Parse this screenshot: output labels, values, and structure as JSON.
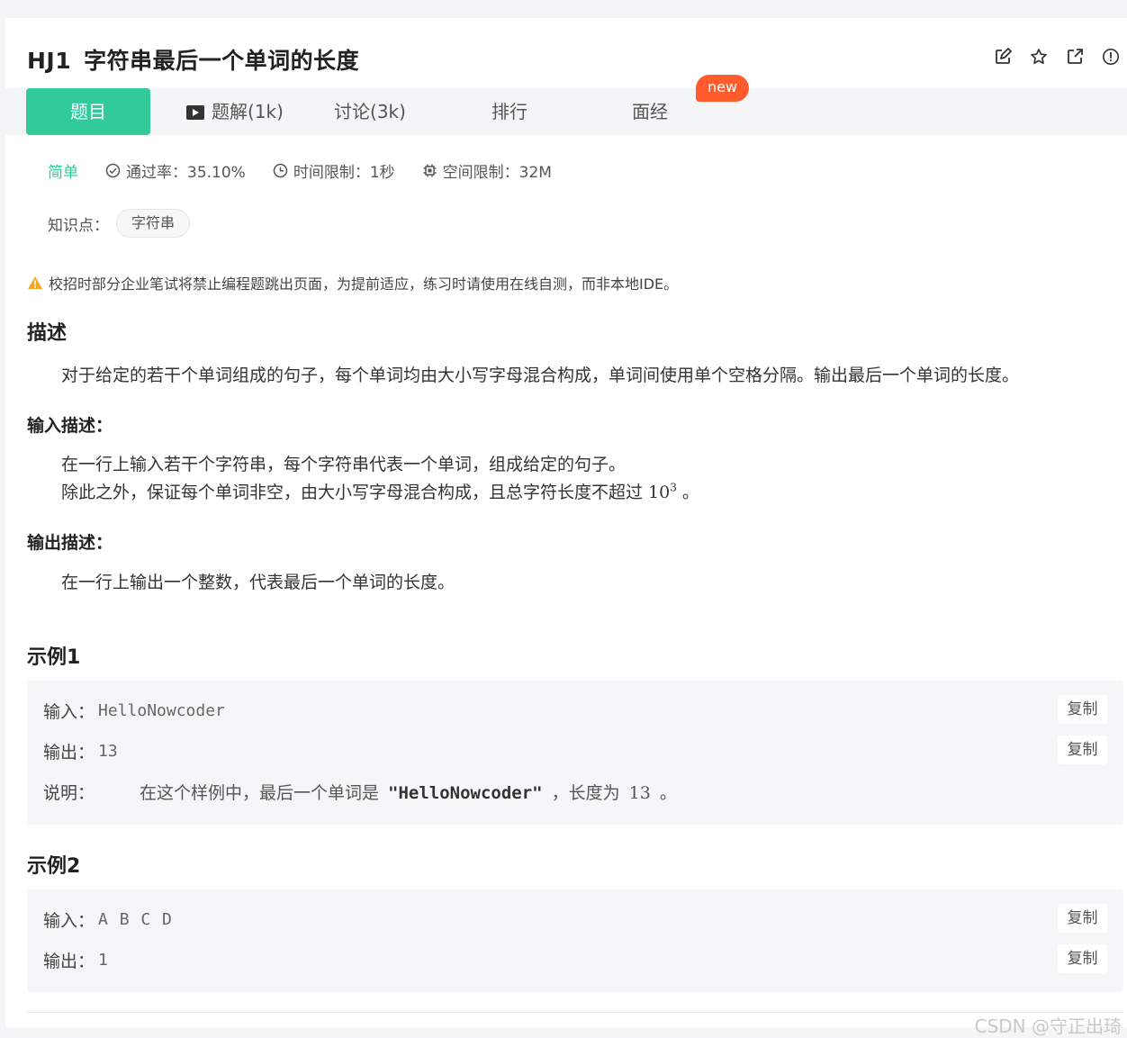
{
  "problem": {
    "code": "HJ1",
    "title": "字符串最后一个单词的长度"
  },
  "icons": [
    "edit-icon",
    "star-icon",
    "share-icon",
    "report-icon"
  ],
  "tabs": [
    {
      "label": "题目",
      "active": true
    },
    {
      "label": "题解(1k)",
      "icon": "video-icon"
    },
    {
      "label": "讨论(3k)"
    },
    {
      "label": "排行"
    },
    {
      "label": "面经"
    }
  ],
  "new_badge": "new",
  "meta": {
    "difficulty": "简单",
    "pass_rate": "通过率：35.10%",
    "time_limit": "时间限制：1秒",
    "space_limit": "空间限制：32M"
  },
  "knowledge": {
    "label": "知识点：",
    "tag": "字符串"
  },
  "warning": "校招时部分企业笔试将禁止编程题跳出页面，为提前适应，练习时请使用在线自测，而非本地IDE。",
  "description": {
    "heading": "描述",
    "text": "对于给定的若干个单词组成的句子，每个单词均由大小写字母混合构成，单词间使用单个空格分隔。输出最后一个单词的长度。"
  },
  "input_desc": {
    "heading": "输入描述：",
    "line1": "在一行上输入若干个字符串，每个字符串代表一个单词，组成给定的句子。",
    "line2_prefix": "除此之外，保证每个单词非空，由大小写字母混合构成，且总字符长度不超过 ",
    "line2_base": "10",
    "line2_exp": "3",
    "line2_suffix": " 。"
  },
  "output_desc": {
    "heading": "输出描述：",
    "text": "在一行上输出一个整数，代表最后一个单词的长度。"
  },
  "examples": [
    {
      "heading": "示例1",
      "input_label": "输入：",
      "input": "HelloNowcoder",
      "output_label": "输出：",
      "output": "13",
      "note_label": "说明：",
      "note_prefix": "在这个样例中，最后一个单词是",
      "note_word": "\"HelloNowcoder\"",
      "note_mid": "，长度为",
      "note_num": "13",
      "note_suffix": "。"
    },
    {
      "heading": "示例2",
      "input_label": "输入：",
      "input": "A B C D",
      "output_label": "输出：",
      "output": "1"
    }
  ],
  "copy_label": "复制",
  "watermark": "CSDN @守正出琦",
  "colors": {
    "accent": "#32ca99",
    "badge": "#ff5b2d",
    "warning": "#f5a623"
  }
}
